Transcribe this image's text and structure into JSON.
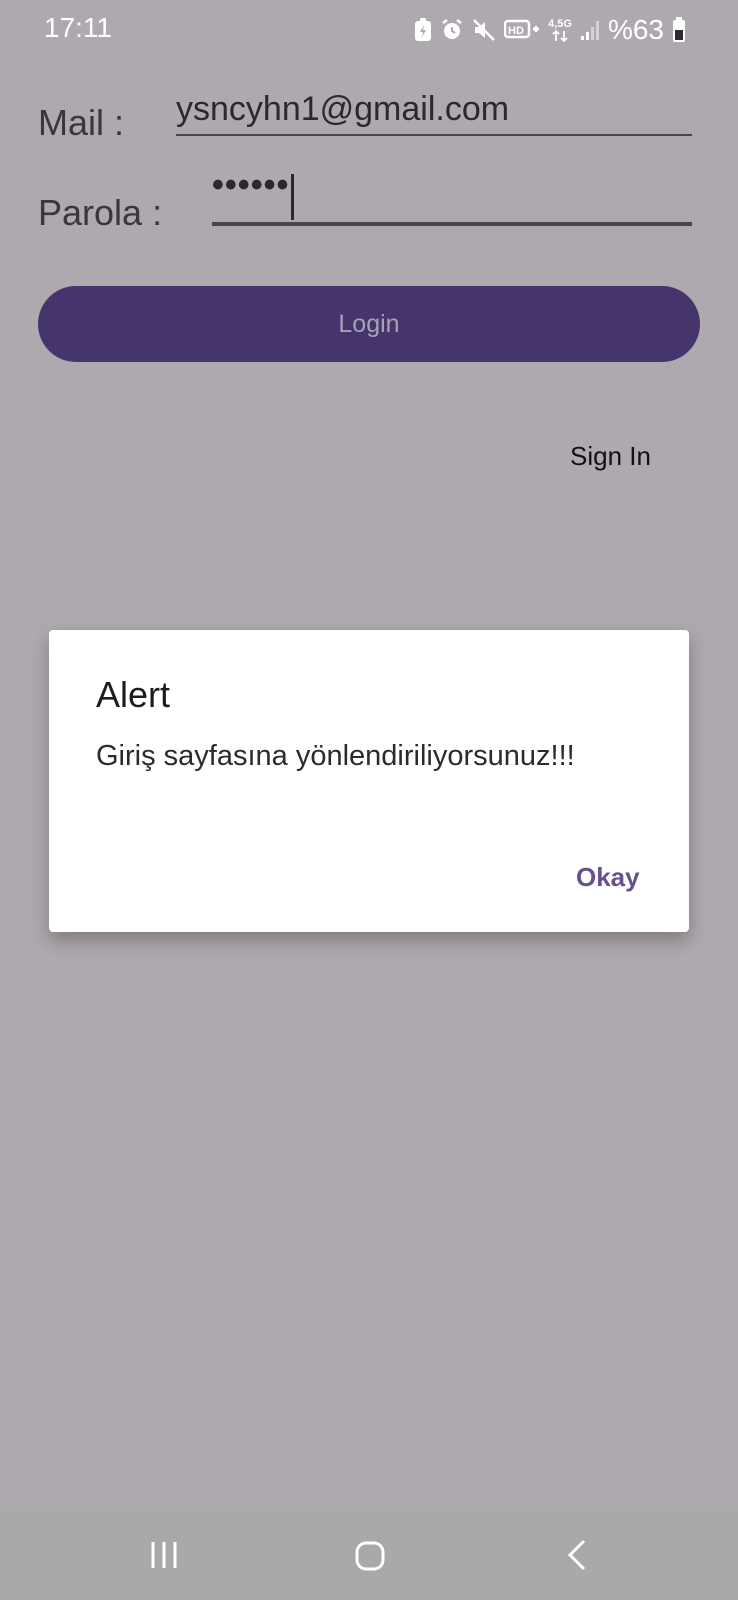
{
  "status_bar": {
    "time": "17:11",
    "battery_percent": "%63",
    "network_label": "4,5G",
    "icons": [
      "battery-saver-icon",
      "alarm-icon",
      "mute-icon",
      "hd-voice-icon",
      "network-4-5g-icon",
      "signal-icon",
      "battery-icon"
    ]
  },
  "form": {
    "mail_label": "Mail :",
    "mail_value": "ysncyhn1@gmail.com",
    "password_label": "Parola :",
    "password_value": "••••••",
    "login_label": "Login",
    "sign_in_label": "Sign In"
  },
  "dialog": {
    "title": "Alert",
    "message": "Giriş sayfasına yönlendiriliyorsunuz!!!",
    "button_label": "Okay"
  },
  "nav_bar": {
    "icons": [
      "recents-icon",
      "home-icon",
      "back-icon"
    ]
  },
  "colors": {
    "background": "#aea9ae",
    "primary_button": "#45356c",
    "dialog_accent": "#655191"
  }
}
